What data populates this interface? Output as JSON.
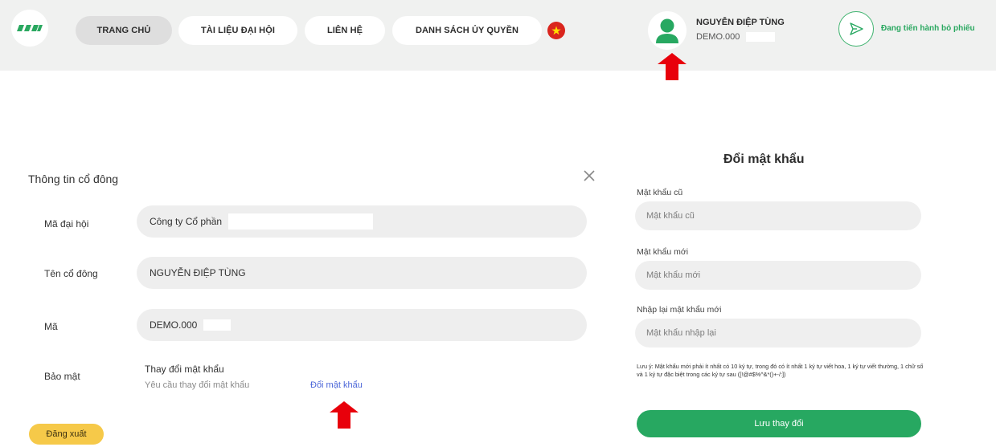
{
  "colors": {
    "accent": "#27a861",
    "header_bg": "#f0f1f0",
    "arrow": "#e8000b",
    "logout": "#f6c949",
    "link": "#4a65d8"
  },
  "header": {
    "logo_icon": "brand-logo-icon",
    "nav": [
      {
        "label": "TRANG CHỦ",
        "active": true
      },
      {
        "label": "TÀI LIỆU ĐẠI HỘI"
      },
      {
        "label": "LIÊN HỆ"
      },
      {
        "label": "DANH SÁCH ỦY QUYỀN"
      }
    ],
    "language_icon": "vietnam-flag-icon",
    "user": {
      "name": "NGUYỄN ĐIỆP TÙNG",
      "code": "DEMO.000",
      "avatar_icon": "user-icon"
    },
    "vote_status": {
      "label": "Đang tiến hành bỏ phiếu",
      "icon": "send-icon"
    }
  },
  "shareholder_panel": {
    "title": "Thông tin cổ đông",
    "close_icon": "close-icon",
    "rows": [
      {
        "label": "Mã đại hội",
        "value": "Công ty Cổ phần"
      },
      {
        "label": "Tên cổ đông",
        "value": "NGUYỄN ĐIỆP TÙNG"
      },
      {
        "label": "Mã",
        "value": "DEMO.000"
      }
    ],
    "security": {
      "label": "Bảo mật",
      "title": "Thay đổi mật khẩu",
      "description": "Yêu cầu thay đổi mật khẩu",
      "link": "Đổi mật khẩu"
    },
    "logout": "Đăng xuất"
  },
  "password_form": {
    "title": "Đổi mật khẩu",
    "fields": [
      {
        "label": "Mật khẩu cũ",
        "placeholder": "Mật khẩu cũ"
      },
      {
        "label": "Mật khẩu mới",
        "placeholder": "Mật khẩu mới"
      },
      {
        "label": "Nhập lại mật khẩu mới",
        "placeholder": "Mật khẩu nhập lại"
      }
    ],
    "note": "Lưu ý: Mật khẩu mới phải ít nhất có 10 ký tự, trong đó có ít nhất 1 ký tự viết hoa, 1 ký tự viết thường, 1 chữ số và 1 ký tự đặc biệt trong các ký tự sau ([!@#$%^&*()+-/:])",
    "save": "Lưu thay đổi"
  }
}
